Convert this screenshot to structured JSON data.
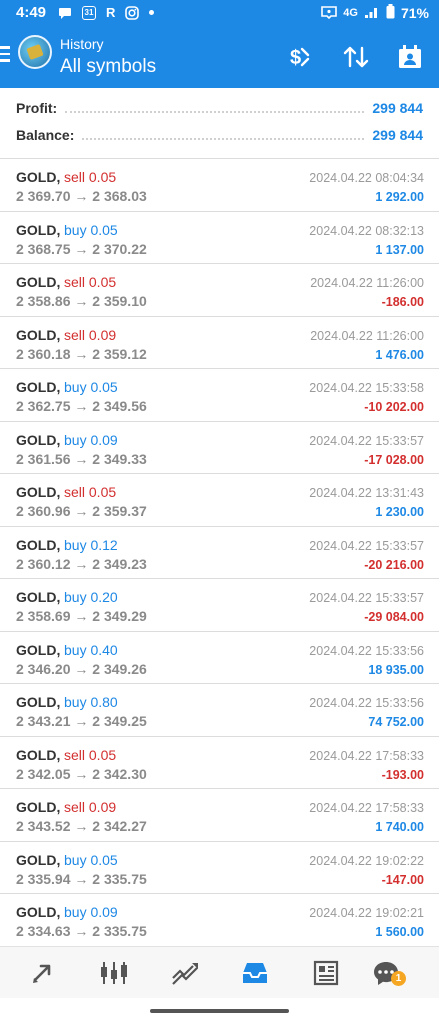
{
  "status_bar": {
    "time": "4:49",
    "calendar_day": "31",
    "r_label": "R",
    "network": "4G",
    "battery": "71%"
  },
  "header": {
    "subtitle": "History",
    "title": "All symbols",
    "accent_color": "#1e88e5"
  },
  "summary": {
    "profit_label": "Profit:",
    "profit_value": "299 844",
    "balance_label": "Balance:",
    "balance_value": "299 844"
  },
  "trades": [
    {
      "symbol": "GOLD,",
      "side": "sell 0.05",
      "prices": "2 369.70 → 2 368.03",
      "time": "2024.04.22 08:04:34",
      "profit": "1 292.00"
    },
    {
      "symbol": "GOLD,",
      "side": "buy 0.05",
      "prices": "2 368.75 → 2 370.22",
      "time": "2024.04.22 08:32:13",
      "profit": "1 137.00"
    },
    {
      "symbol": "GOLD,",
      "side": "sell 0.05",
      "prices": "2 358.86 → 2 359.10",
      "time": "2024.04.22 11:26:00",
      "profit": "-186.00"
    },
    {
      "symbol": "GOLD,",
      "side": "sell 0.09",
      "prices": "2 360.18 → 2 359.12",
      "time": "2024.04.22 11:26:00",
      "profit": "1 476.00"
    },
    {
      "symbol": "GOLD,",
      "side": "buy 0.05",
      "prices": "2 362.75 → 2 349.56",
      "time": "2024.04.22 15:33:58",
      "profit": "-10 202.00"
    },
    {
      "symbol": "GOLD,",
      "side": "buy 0.09",
      "prices": "2 361.56 → 2 349.33",
      "time": "2024.04.22 15:33:57",
      "profit": "-17 028.00"
    },
    {
      "symbol": "GOLD,",
      "side": "sell 0.05",
      "prices": "2 360.96 → 2 359.37",
      "time": "2024.04.22 13:31:43",
      "profit": "1 230.00"
    },
    {
      "symbol": "GOLD,",
      "side": "buy 0.12",
      "prices": "2 360.12 → 2 349.23",
      "time": "2024.04.22 15:33:57",
      "profit": "-20 216.00"
    },
    {
      "symbol": "GOLD,",
      "side": "buy 0.20",
      "prices": "2 358.69 → 2 349.29",
      "time": "2024.04.22 15:33:57",
      "profit": "-29 084.00"
    },
    {
      "symbol": "GOLD,",
      "side": "buy 0.40",
      "prices": "2 346.20 → 2 349.26",
      "time": "2024.04.22 15:33:56",
      "profit": "18 935.00"
    },
    {
      "symbol": "GOLD,",
      "side": "buy 0.80",
      "prices": "2 343.21 → 2 349.25",
      "time": "2024.04.22 15:33:56",
      "profit": "74 752.00"
    },
    {
      "symbol": "GOLD,",
      "side": "sell 0.05",
      "prices": "2 342.05 → 2 342.30",
      "time": "2024.04.22 17:58:33",
      "profit": "-193.00"
    },
    {
      "symbol": "GOLD,",
      "side": "sell 0.09",
      "prices": "2 343.52 → 2 342.27",
      "time": "2024.04.22 17:58:33",
      "profit": "1 740.00"
    },
    {
      "symbol": "GOLD,",
      "side": "buy 0.05",
      "prices": "2 335.94 → 2 335.75",
      "time": "2024.04.22 19:02:22",
      "profit": "-147.00"
    },
    {
      "symbol": "GOLD,",
      "side": "buy 0.09",
      "prices": "2 334.63 → 2 335.75",
      "time": "2024.04.22 19:02:21",
      "profit": "1 560.00"
    }
  ],
  "bottom_nav": {
    "items": [
      "quotes-icon",
      "chart-icon",
      "trade-icon",
      "history-icon",
      "news-icon",
      "chat-icon"
    ],
    "active": "history-icon",
    "chat_badge": "1"
  }
}
